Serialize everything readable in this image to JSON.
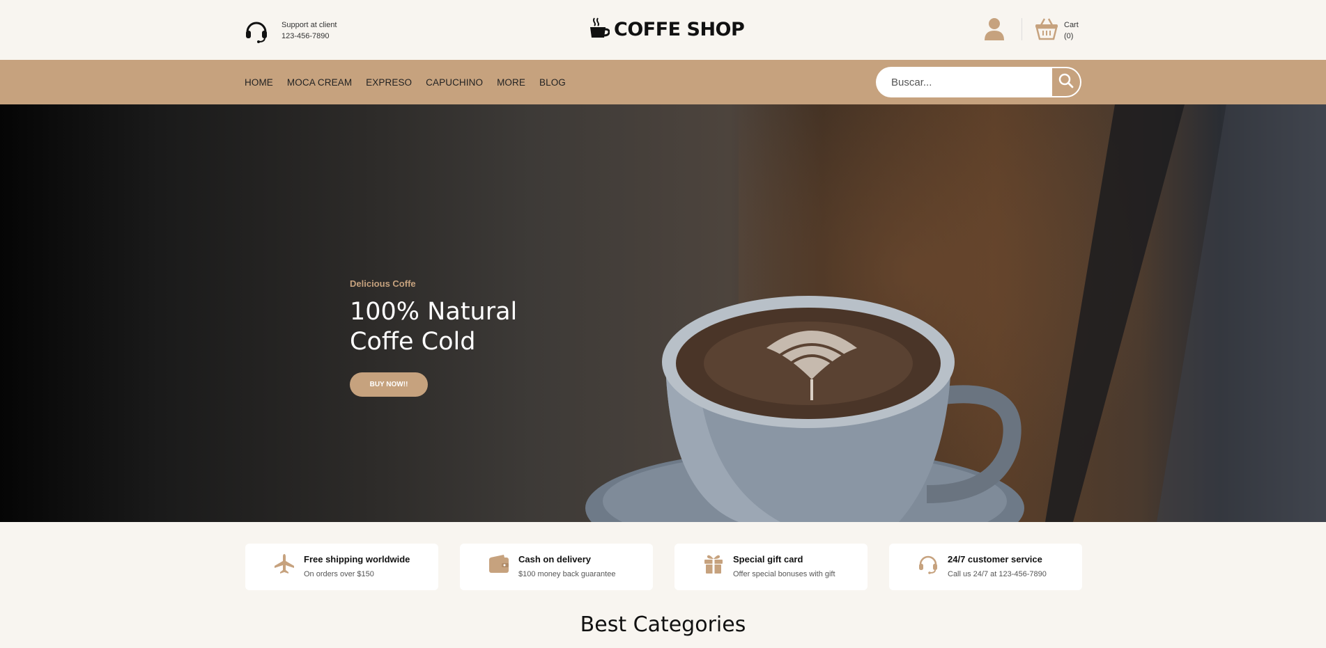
{
  "header": {
    "support_label": "Support at client",
    "support_phone": "123-456-7890",
    "logo_text": "COFFE SHOP",
    "cart_label": "Cart",
    "cart_count": "(0)"
  },
  "nav": {
    "items": [
      "HOME",
      "MOCA CREAM",
      "EXPRESO",
      "CAPUCHINO",
      "MORE",
      "BLOG"
    ]
  },
  "search": {
    "placeholder": "Buscar..."
  },
  "hero": {
    "subtitle": "Delicious Coffe",
    "title_line1": "100% Natural",
    "title_line2": "Coffe Cold",
    "button_label": "BUY NOW!!"
  },
  "features": [
    {
      "icon": "airplane-icon",
      "title": "Free shipping worldwide",
      "desc": "On orders over $150"
    },
    {
      "icon": "wallet-icon",
      "title": "Cash on delivery",
      "desc": "$100 money back guarantee"
    },
    {
      "icon": "gift-icon",
      "title": "Special gift card",
      "desc": "Offer special bonuses with gift"
    },
    {
      "icon": "headset-icon",
      "title": "24/7 customer service",
      "desc": "Call us 24/7 at 123-456-7890"
    }
  ],
  "sections": {
    "categories_title": "Best Categories"
  },
  "colors": {
    "accent": "#c6a27e",
    "background": "#f8f5f0",
    "text": "#111111"
  }
}
